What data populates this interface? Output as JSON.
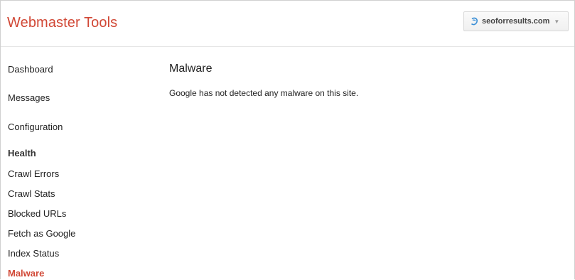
{
  "header": {
    "title": "Webmaster Tools",
    "site_selector": {
      "label": "seoforresults.com",
      "icon": "site-globe-icon",
      "dropdown_icon": "chevron-down-icon"
    }
  },
  "sidebar": {
    "items": [
      {
        "label": "Dashboard"
      },
      {
        "label": "Messages"
      },
      {
        "label": "Configuration"
      },
      {
        "label": "Health"
      },
      {
        "label": "Crawl Errors"
      },
      {
        "label": "Crawl Stats"
      },
      {
        "label": "Blocked URLs"
      },
      {
        "label": "Fetch as Google"
      },
      {
        "label": "Index Status"
      },
      {
        "label": "Malware"
      }
    ]
  },
  "main": {
    "title": "Malware",
    "status": "Google has not detected any malware on this site."
  },
  "colors": {
    "brand": "#d14836",
    "active_nav": "#d14836",
    "text": "#222222",
    "border": "#e6e6e6"
  }
}
